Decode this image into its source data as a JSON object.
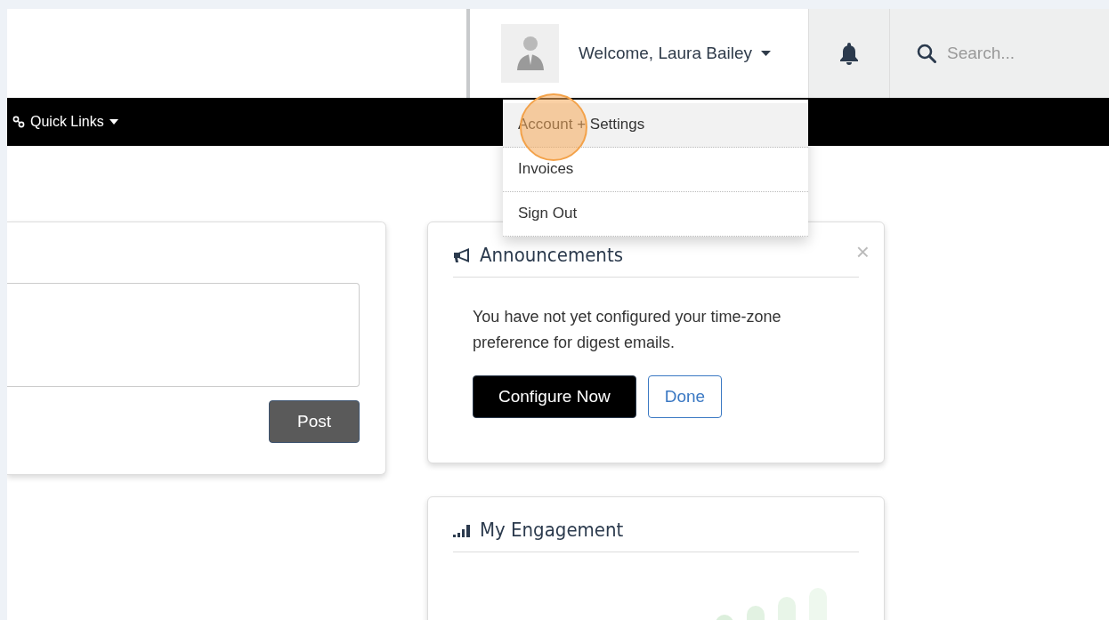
{
  "header": {
    "user_menu": {
      "label": "Welcome, Laura Bailey",
      "expanded": true,
      "items": [
        {
          "label": "Account + Settings",
          "selected": true
        },
        {
          "label": "Invoices",
          "selected": false
        },
        {
          "label": "Sign Out",
          "selected": false
        }
      ]
    },
    "search": {
      "placeholder": "Search..."
    }
  },
  "nav": {
    "items": [
      {
        "label": "Quick Links"
      }
    ]
  },
  "post_card": {
    "button": "Post"
  },
  "announcements": {
    "title": "Announcements",
    "close": "×",
    "message": "You have not yet configured your time-zone preference for digest emails.",
    "buttons": [
      {
        "label": "Configure Now",
        "kind": "primary"
      },
      {
        "label": "Done",
        "kind": "secondary"
      }
    ]
  },
  "engagement": {
    "title": "My Engagement"
  }
}
